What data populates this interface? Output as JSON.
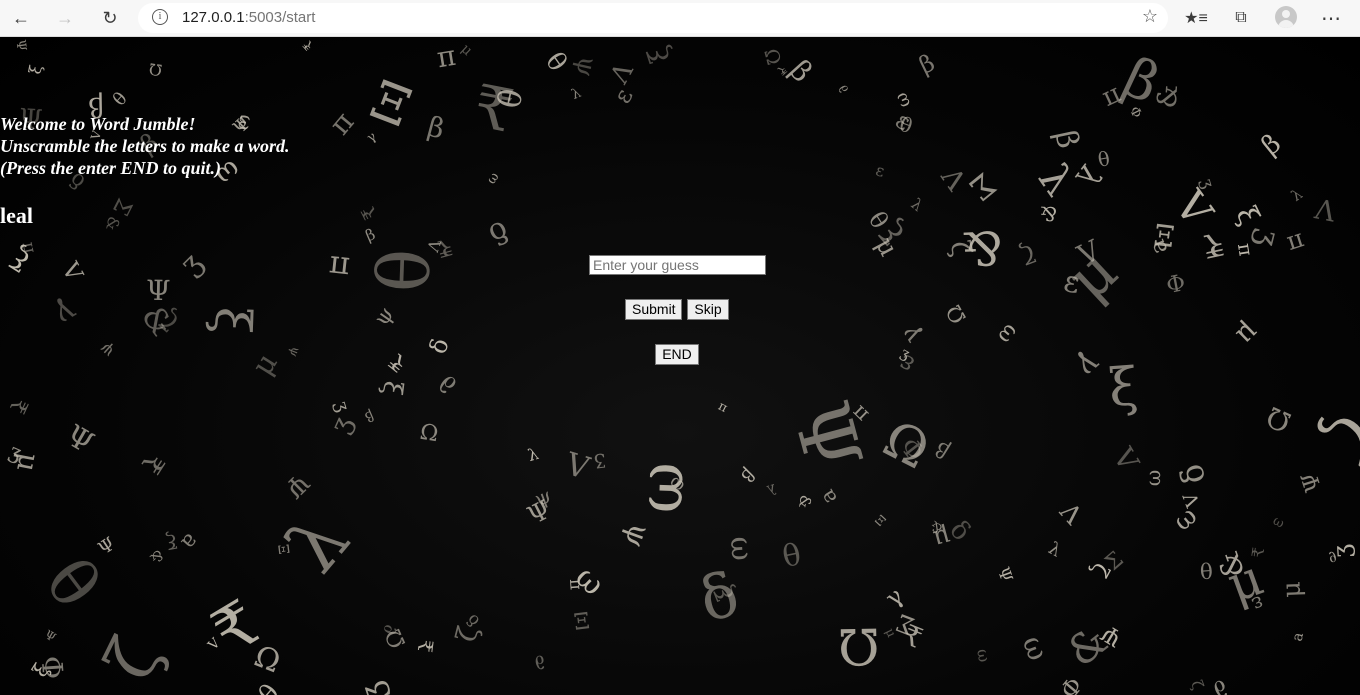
{
  "browser": {
    "url_host": "127.0.0.1",
    "url_rest": ":5003/start"
  },
  "page": {
    "welcome_lines": [
      "Welcome to Word Jumble!",
      "Unscramble the letters to make a word.",
      "(Press the enter END to quit.)"
    ],
    "jumbled_word": "leal",
    "guess_placeholder": "Enter your guess",
    "guess_value": "",
    "submit_label": "Submit",
    "skip_label": "Skip",
    "end_label": "END"
  },
  "colors": {
    "page_background": "#000000",
    "text": "#ffffff",
    "glyphs": "#c9c3b6"
  },
  "icons": [
    "back-icon",
    "forward-icon",
    "refresh-icon",
    "site-info-icon",
    "favorite-star-icon",
    "favorites-icon",
    "collections-icon",
    "profile-avatar",
    "more-icon"
  ]
}
